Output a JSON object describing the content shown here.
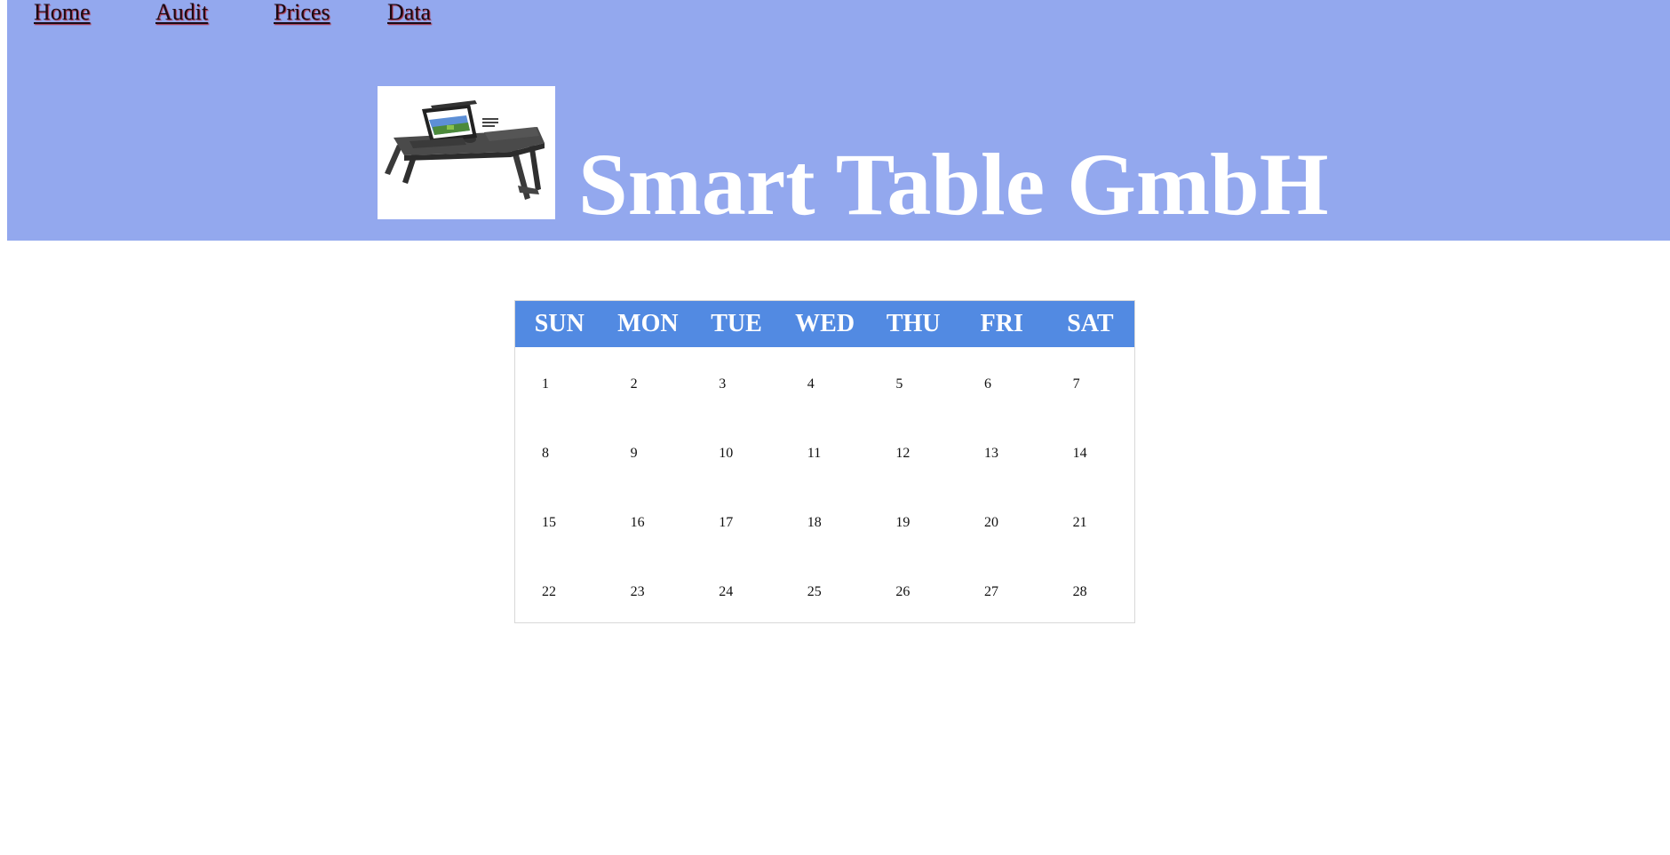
{
  "nav": {
    "items": [
      {
        "label": "Home"
      },
      {
        "label": "Audit"
      },
      {
        "label": "Prices"
      },
      {
        "label": "Data"
      }
    ]
  },
  "brand": {
    "title": "Smart Table GmbH",
    "logo": "laptop-table-product-image"
  },
  "colors": {
    "header_bg": "#93a8ee",
    "calendar_header_bg": "#528ae2",
    "title_text": "#ffffff"
  },
  "calendar": {
    "days": [
      "SUN",
      "MON",
      "TUE",
      "WED",
      "THU",
      "FRI",
      "SAT"
    ],
    "weeks": [
      [
        "1",
        "2",
        "3",
        "4",
        "5",
        "6",
        "7"
      ],
      [
        "8",
        "9",
        "10",
        "11",
        "12",
        "13",
        "14"
      ],
      [
        "15",
        "16",
        "17",
        "18",
        "19",
        "20",
        "21"
      ],
      [
        "22",
        "23",
        "24",
        "25",
        "26",
        "27",
        "28"
      ]
    ]
  }
}
